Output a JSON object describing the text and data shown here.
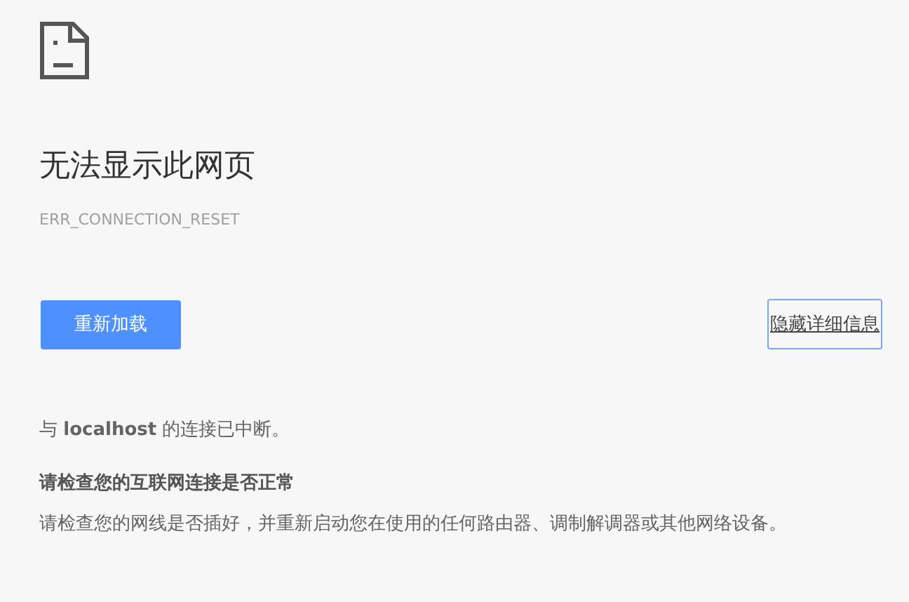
{
  "title": "无法显示此网页",
  "error_code": "ERR_CONNECTION_RESET",
  "reload_button": "重新加载",
  "details_button": "隐藏详细信息",
  "summary": "与 **localhost** 的连接已中断。",
  "suggestion": {
    "heading": "请检查您的互联网连接是否正常",
    "body": "请检查您的网线是否插好，并重新启动您在使用的任何路由器、调制解调器或其他网络设备。"
  }
}
